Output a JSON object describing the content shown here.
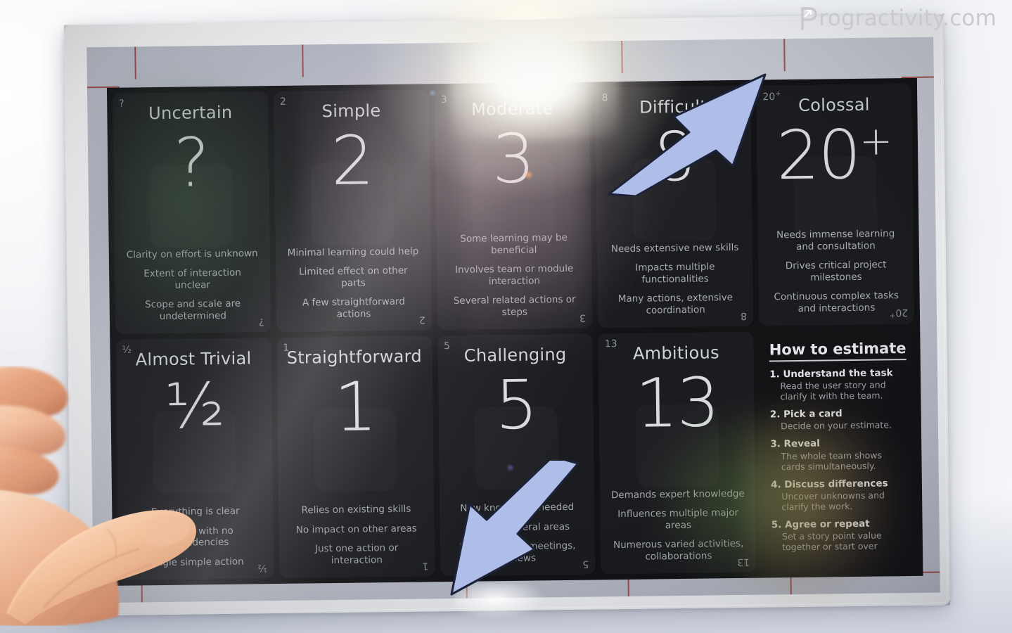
{
  "watermark": {
    "text": "Progractivity.com",
    "logo_icon": "arrow-in-p-logo-icon",
    "color": "#c9cacd"
  },
  "poster": {
    "kind": "story-point-estimation-card-deck",
    "background_color": "#131316",
    "accent_color": "#aebee8",
    "crop_mark_color": "#9b3b3b"
  },
  "cards": [
    {
      "title": "Uncertain",
      "value": "?",
      "corner": "?",
      "bullets": [
        "Clarity on effort is unknown",
        "Extent of interaction unclear",
        "Scope and scale are undetermined"
      ]
    },
    {
      "title": "Simple",
      "value": "2",
      "corner": "2",
      "bullets": [
        "Minimal learning could help",
        "Limited effect on other parts",
        "A few straightforward actions"
      ]
    },
    {
      "title": "Moderate",
      "value": "3",
      "corner": "3",
      "bullets": [
        "Some learning may be beneficial",
        "Involves team or module interaction",
        "Several related actions or steps"
      ]
    },
    {
      "title": "Difficult",
      "value": "8",
      "corner": "8",
      "bullets": [
        "Needs extensive new skills",
        "Impacts multiple functionalities",
        "Many actions, extensive coordination"
      ]
    },
    {
      "title": "Colossal",
      "value": "20",
      "value_suffix": "+",
      "corner": "20",
      "corner_suffix": "+",
      "bullets": [
        "Needs immense learning and consultation",
        "Drives critical project milestones",
        "Continuous complex tasks and interactions"
      ]
    },
    {
      "title": "Almost Trivial",
      "value": "½",
      "corner": "½",
      "bullets": [
        "Everything is clear",
        "Isolated with no dependencies",
        "Single simple action"
      ]
    },
    {
      "title": "Straightforward",
      "value": "1",
      "corner": "1",
      "bullets": [
        "Relies on existing skills",
        "No impact on other areas",
        "Just one action or interaction"
      ]
    },
    {
      "title": "Challenging",
      "value": "5",
      "corner": "5",
      "bullets": [
        "New knowledge needed",
        "Touches several areas",
        "Many actions, meetings, reviews"
      ]
    },
    {
      "title": "Ambitious",
      "value": "13",
      "corner": "13",
      "bullets": [
        "Demands expert knowledge",
        "Influences multiple major areas",
        "Numerous varied activities, collaborations"
      ]
    }
  ],
  "howto": {
    "title": "How to estimate",
    "steps": [
      {
        "num": "1.",
        "head": "Understand the task",
        "body": "Read the user story and clarify it with the team."
      },
      {
        "num": "2.",
        "head": "Pick a card",
        "body": "Decide on your estimate."
      },
      {
        "num": "3.",
        "head": "Reveal",
        "body": "The whole team shows cards simultaneously."
      },
      {
        "num": "4.",
        "head": "Discuss differences",
        "body": "Uncover unknowns and clarify the work."
      },
      {
        "num": "5.",
        "head": "Agree or repeat",
        "body": "Set a story point value together or start over"
      }
    ]
  },
  "annotations": [
    {
      "name": "arrow-up-right",
      "icon": "arrow-up-right-icon",
      "points_at": "Difficult card"
    },
    {
      "name": "arrow-down-left",
      "icon": "arrow-down-left-icon",
      "points_at": "Challenging card"
    }
  ],
  "photo": {
    "hand_icon": "hand-holding-sheet-icon",
    "glare_icon": "sun-flare-icon"
  }
}
